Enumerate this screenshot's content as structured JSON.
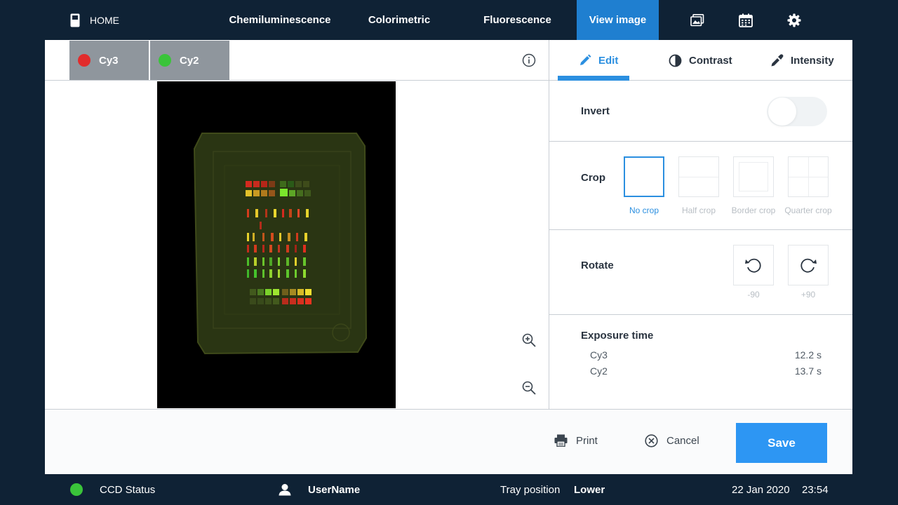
{
  "nav": {
    "home": "HOME",
    "tabs": [
      "Chemiluminescence",
      "Colorimetric",
      "Fluorescence",
      "View image"
    ],
    "active_tab": "View image",
    "icons": [
      "gallery-icon",
      "calendar-icon",
      "gear-icon"
    ]
  },
  "channels": [
    {
      "label": "Cy3",
      "color": "#e12c2c"
    },
    {
      "label": "Cy2",
      "color": "#3ac43a"
    }
  ],
  "edit_tabs": {
    "edit": "Edit",
    "contrast": "Contrast",
    "intensity": "Intensity",
    "active": "Edit"
  },
  "invert": {
    "label": "Invert",
    "on": false
  },
  "crop": {
    "label": "Crop",
    "options": [
      "No crop",
      "Half crop",
      "Border crop",
      "Quarter crop"
    ],
    "selected": "No crop"
  },
  "rotate": {
    "label": "Rotate",
    "options": [
      "-90",
      "+90"
    ]
  },
  "exposure": {
    "label": "Exposure time",
    "rows": [
      {
        "name": "Cy3",
        "value": "12.2 s"
      },
      {
        "name": "Cy2",
        "value": "13.7 s"
      }
    ]
  },
  "actions": {
    "print": "Print",
    "cancel": "Cancel",
    "save": "Save"
  },
  "status": {
    "ccd_label": "CCD Status",
    "ccd_color": "#3ac43a",
    "user": "UserName",
    "tray_label": "Tray position",
    "tray_value": "Lower",
    "date": "22 Jan 2020",
    "time": "23:54"
  },
  "colors": {
    "accent": "#2b8fe0",
    "nav_bg": "#0f2235",
    "save_bg": "#2d96f3"
  }
}
